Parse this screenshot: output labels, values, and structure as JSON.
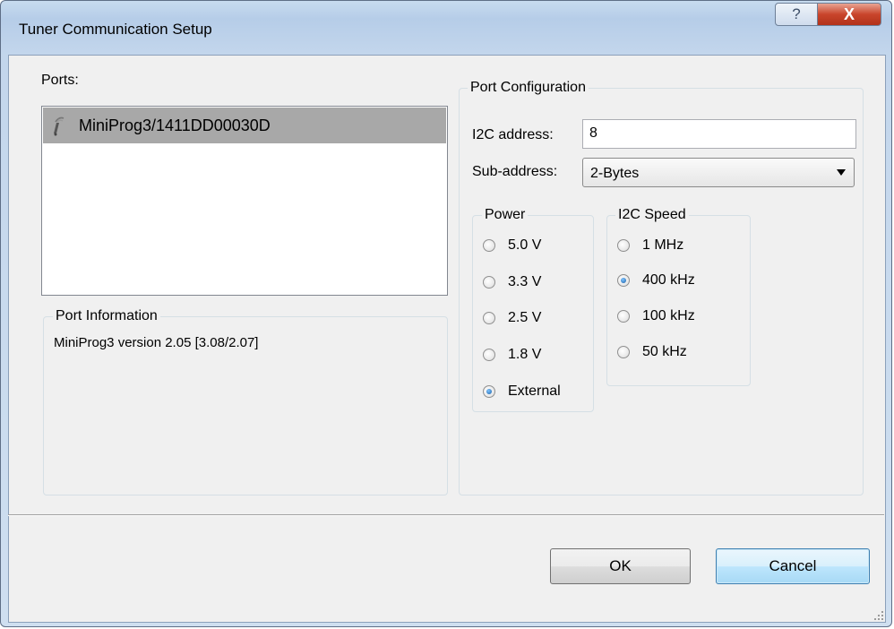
{
  "window": {
    "title": "Tuner Communication Setup",
    "help_glyph": "?",
    "close_glyph": "X"
  },
  "ports": {
    "label": "Ports:",
    "items": [
      {
        "name": "MiniProg3/1411DD00030D",
        "icon": "probe-icon",
        "selected": true
      }
    ]
  },
  "port_information": {
    "legend": "Port Information",
    "text": "MiniProg3 version 2.05 [3.08/2.07]"
  },
  "port_configuration": {
    "legend": "Port Configuration",
    "i2c_address_label": "I2C address:",
    "i2c_address_value": "8",
    "sub_address_label": "Sub-address:",
    "sub_address_value": "2-Bytes"
  },
  "power": {
    "legend": "Power",
    "options": [
      {
        "label": "5.0 V",
        "checked": false
      },
      {
        "label": "3.3 V",
        "checked": false
      },
      {
        "label": "2.5 V",
        "checked": false
      },
      {
        "label": "1.8 V",
        "checked": false
      },
      {
        "label": "External",
        "checked": true
      }
    ]
  },
  "i2c_speed": {
    "legend": "I2C Speed",
    "options": [
      {
        "label": "1 MHz",
        "checked": false
      },
      {
        "label": "400 kHz",
        "checked": true
      },
      {
        "label": "100 kHz",
        "checked": false
      },
      {
        "label": "50 kHz",
        "checked": false
      }
    ]
  },
  "buttons": {
    "ok": "OK",
    "cancel": "Cancel"
  },
  "colors": {
    "selection": "#a8a8a8",
    "default_button_border": "#3c7fb1",
    "close_button": "#c9452c"
  }
}
